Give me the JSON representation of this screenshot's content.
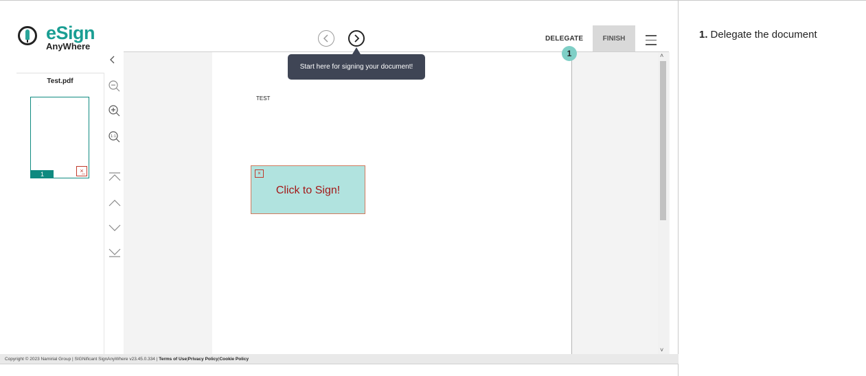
{
  "app": {
    "logo_main": "eSign",
    "logo_sub": "AnyWhere"
  },
  "nav": {
    "prev_icon": "chevron-left-circle-icon",
    "next_icon": "chevron-right-circle-icon"
  },
  "header": {
    "delegate_label": "DELEGATE",
    "finish_label": "FINISH",
    "menu_icon": "hamburger-menu-icon",
    "step_badge": "1"
  },
  "tooltip": {
    "text": "Start here for signing your document!"
  },
  "thumbnails": {
    "title": "Test.pdf",
    "page_number": "1",
    "signature_marker": "signature-field-icon"
  },
  "tools": [
    "zoom-out-icon",
    "zoom-in-icon",
    "zoom-reset-icon",
    "first-page-icon",
    "previous-page-icon",
    "next-page-icon",
    "last-page-icon"
  ],
  "document": {
    "text": "TEST",
    "sign_field_label": "Click to Sign!"
  },
  "footer": {
    "copyright": "Copyright © 2023 Namirial Group | SIGNificant SignAnyWhere v23.45.0.334 |",
    "terms": "Terms of Use",
    "privacy": "Privacy Policy",
    "cookie": "Cookie Policy"
  },
  "instructions": {
    "number": "1.",
    "text": "Delegate the document"
  },
  "colors": {
    "brand_teal": "#1a9e93",
    "sign_field_bg": "#b1e3df",
    "sign_label": "#a31818",
    "tooltip_bg": "#3f4555"
  }
}
